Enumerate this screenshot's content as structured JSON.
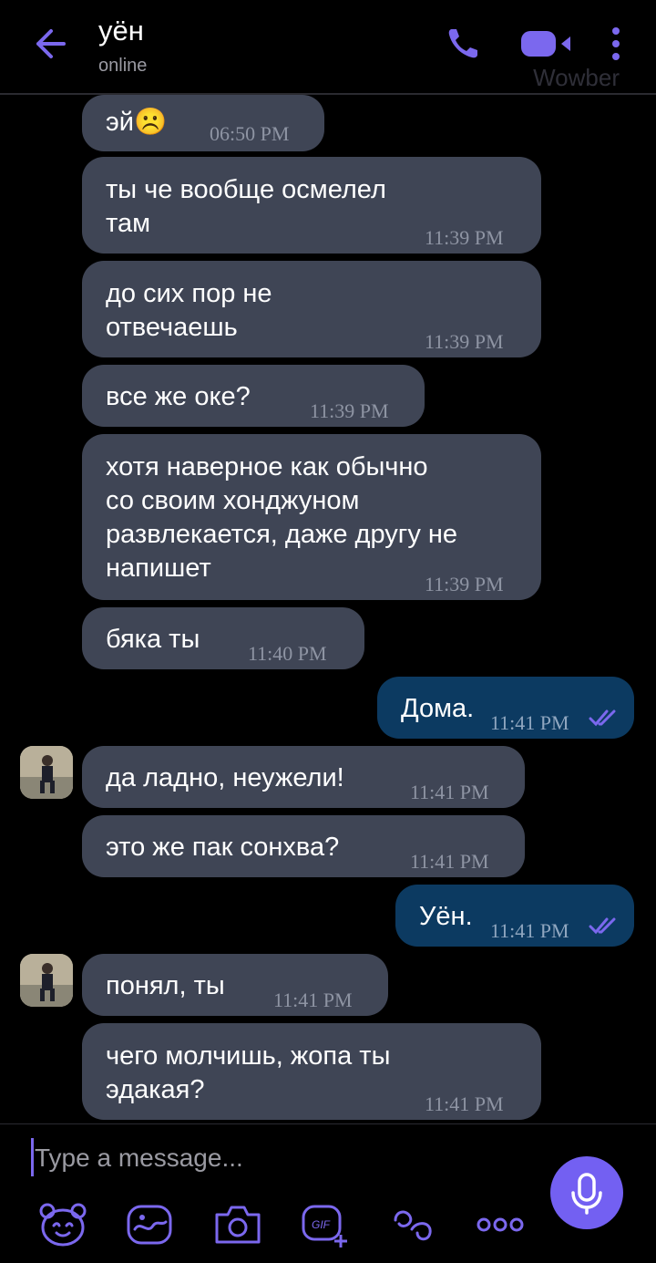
{
  "header": {
    "contact_name": "уён",
    "status": "online",
    "brand": "Wowber",
    "icons": [
      "back-arrow-icon",
      "phone-icon",
      "video-call-icon",
      "more-vert-icon"
    ]
  },
  "messages": [
    {
      "dir": "in",
      "text": "эй☹️",
      "time": "06:50 PM"
    },
    {
      "dir": "in",
      "text": "ты че вообще осмелел\nтам",
      "time": "11:39 PM"
    },
    {
      "dir": "in",
      "text": "до сих пор не\nотвечаешь",
      "time": "11:39 PM"
    },
    {
      "dir": "in",
      "text": "все же оке?",
      "time": "11:39 PM"
    },
    {
      "dir": "in",
      "text": "хотя наверное как обычно\nсо своим хонджуном\nразвлекается, даже другу не\nнапишет",
      "time": "11:39 PM"
    },
    {
      "dir": "in",
      "text": "бяка ты",
      "time": "11:40 PM"
    },
    {
      "dir": "out",
      "text": "Дома.",
      "time": "11:41 PM"
    },
    {
      "dir": "in",
      "text": "да ладно, неужели!",
      "time": "11:41 PM"
    },
    {
      "dir": "in",
      "text": "это же пак сонхва?",
      "time": "11:41 PM"
    },
    {
      "dir": "out",
      "text": "Уён.",
      "time": "11:41 PM"
    },
    {
      "dir": "in",
      "text": "понял, ты",
      "time": "11:41 PM"
    },
    {
      "dir": "in",
      "text": "чего молчишь, жопа ты\nэдакая?",
      "time": "11:41 PM"
    }
  ],
  "composer": {
    "placeholder": "Type a message...",
    "toolbar_icons": [
      "sticker-bear-icon",
      "doodle-icon",
      "camera-icon",
      "gif-icon",
      "emoticon-icon",
      "more-horizontal-icon"
    ],
    "mic_icon": "microphone-icon"
  },
  "colors": {
    "accent": "#7360f2",
    "incoming_bubble": "#3f4555",
    "outgoing_bubble": "#0c3a61",
    "background": "#000000"
  }
}
